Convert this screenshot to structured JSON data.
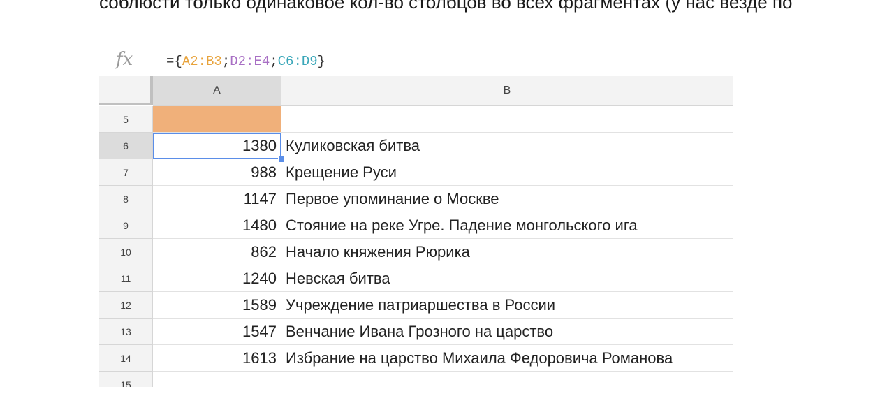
{
  "top_text": "соблюсти только одинаковое кол-во столбцов во всех фрагментах (у нас везде по",
  "formula_bar": {
    "fx_label": "fx",
    "prefix": "={",
    "ranges": [
      {
        "text": "A2:B3",
        "color": "#e8a33c"
      },
      {
        "text": ";",
        "color": "#333333"
      },
      {
        "text": "D2:E4",
        "color": "#a86fc4"
      },
      {
        "text": ";",
        "color": "#333333"
      },
      {
        "text": "C6:D9",
        "color": "#3aa7b9"
      }
    ],
    "suffix": "}"
  },
  "columns": [
    "A",
    "B"
  ],
  "rows": [
    {
      "num": "5",
      "a": "",
      "b": ""
    },
    {
      "num": "6",
      "a": "1380",
      "b": "Куликовская битва"
    },
    {
      "num": "7",
      "a": "988",
      "b": "Крещение Руси"
    },
    {
      "num": "8",
      "a": "1147",
      "b": "Первое упоминание о Москве"
    },
    {
      "num": "9",
      "a": "1480",
      "b": "Стояние на реке Угре. Падение монгольского ига"
    },
    {
      "num": "10",
      "a": "862",
      "b": "Начало княжения Рюрика"
    },
    {
      "num": "11",
      "a": "1240",
      "b": "Невская битва"
    },
    {
      "num": "12",
      "a": "1589",
      "b": "Учреждение патриаршества в России"
    },
    {
      "num": "13",
      "a": "1547",
      "b": "Венчание Ивана Грозного на царство"
    },
    {
      "num": "14",
      "a": "1613",
      "b": "Избрание на царство Михаила Федоровича Романова"
    },
    {
      "num": "15",
      "a": "",
      "b": ""
    }
  ],
  "selected_cell": "A6",
  "colors": {
    "highlight_fill": "#f0b07a",
    "selection": "#5b8ee8"
  }
}
